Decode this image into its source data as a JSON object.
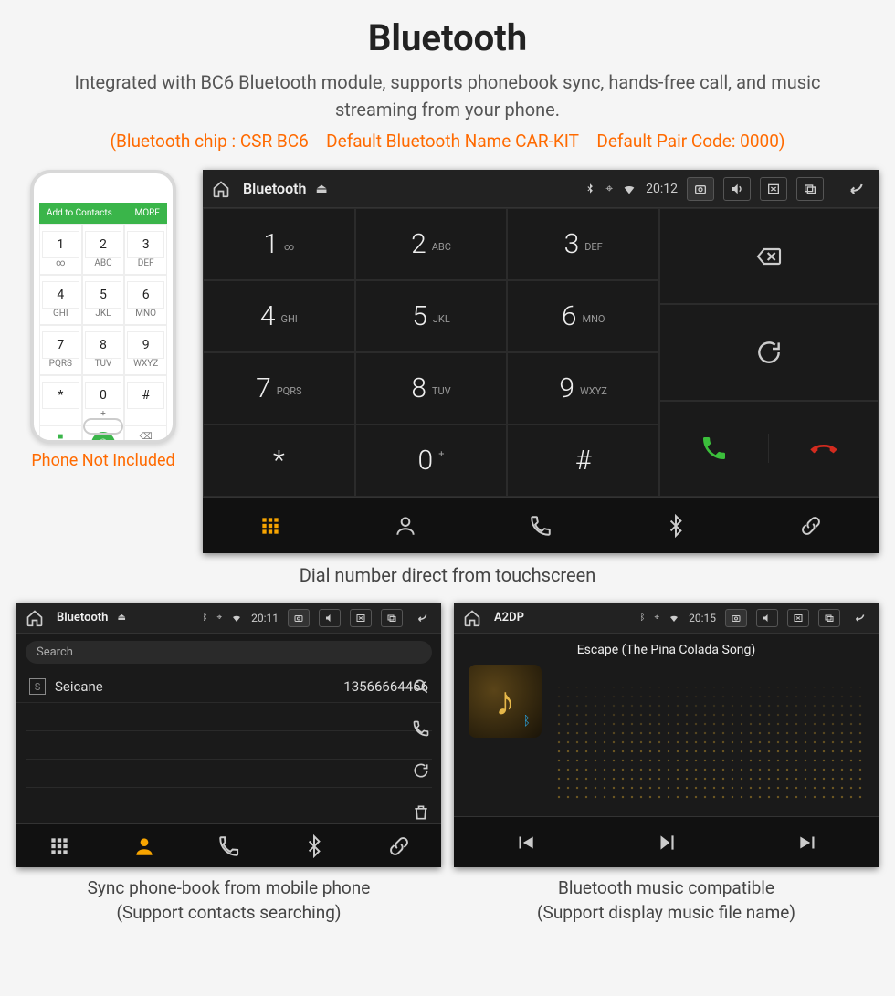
{
  "title": "Bluetooth",
  "subtitle": "Integrated with BC6 Bluetooth module, supports phonebook sync, hands-free call, and music streaming from your phone.",
  "specs": "(Bluetooth chip : CSR BC6 Default Bluetooth Name CAR-KIT Default Pair Code: 0000)",
  "phone": {
    "header_left": "Add to Contacts",
    "header_right": "MORE",
    "caption": "Phone Not Included"
  },
  "main_panel": {
    "status": {
      "title": "Bluetooth",
      "time": "20:12"
    },
    "keys": [
      {
        "digit": "1",
        "letters": "∞"
      },
      {
        "digit": "2",
        "letters": "ABC"
      },
      {
        "digit": "3",
        "letters": "DEF"
      },
      {
        "digit": "4",
        "letters": "GHI"
      },
      {
        "digit": "5",
        "letters": "JKL"
      },
      {
        "digit": "6",
        "letters": "MNO"
      },
      {
        "digit": "7",
        "letters": "PQRS"
      },
      {
        "digit": "8",
        "letters": "TUV"
      },
      {
        "digit": "9",
        "letters": "WXYZ"
      },
      {
        "digit": "*",
        "letters": ""
      },
      {
        "digit": "0",
        "letters": "+"
      },
      {
        "digit": "#",
        "letters": ""
      }
    ],
    "caption": "Dial number direct from touchscreen"
  },
  "phonebook_panel": {
    "status": {
      "title": "Bluetooth",
      "time": "20:11"
    },
    "search_placeholder": "Search",
    "contact": {
      "badge": "S",
      "name": "Seicane",
      "number": "13566664466"
    },
    "caption_l1": "Sync phone-book from mobile phone",
    "caption_l2": "(Support contacts searching)"
  },
  "a2dp_panel": {
    "status": {
      "title": "A2DP",
      "time": "20:15"
    },
    "song": "Escape (The Pina Colada Song)",
    "caption_l1": "Bluetooth music compatible",
    "caption_l2": "(Support display music file name)"
  }
}
